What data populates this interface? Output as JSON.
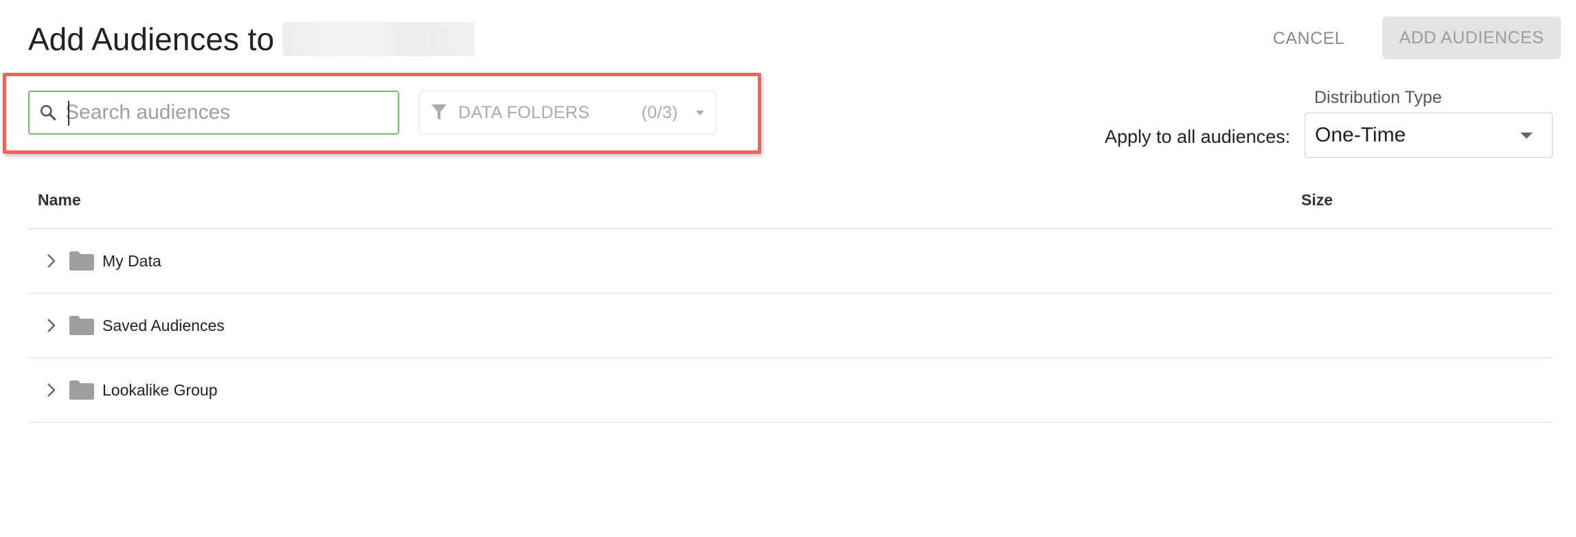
{
  "header": {
    "title": "Add Audiences to",
    "cancel_label": "CANCEL",
    "add_label": "ADD AUDIENCES"
  },
  "search": {
    "placeholder": "Search audiences",
    "value": ""
  },
  "folders_filter": {
    "label": "DATA FOLDERS",
    "count": "(0/3)"
  },
  "distribution": {
    "label": "Distribution Type",
    "apply_label": "Apply to all audiences:",
    "selected": "One-Time"
  },
  "table": {
    "columns": [
      "Name",
      "Size"
    ],
    "rows": [
      {
        "label": "My Data"
      },
      {
        "label": "Saved Audiences"
      },
      {
        "label": "Lookalike Group"
      }
    ]
  },
  "colors": {
    "highlight": "#e8665b",
    "search_border": "#6cc46a",
    "folder_icon": "#9e9e9e"
  }
}
